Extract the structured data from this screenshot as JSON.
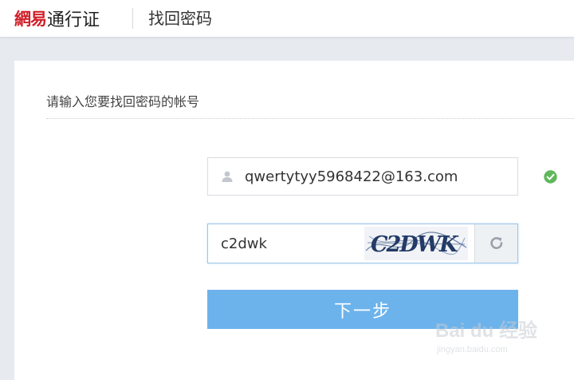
{
  "header": {
    "brand": "網易",
    "product": "通行证",
    "page_title": "找回密码"
  },
  "main": {
    "section_title": "请输入您要找回密码的帐号",
    "account": {
      "value": "qwertytyy5968422@163.com",
      "icon": "user-icon",
      "status_icon": "check-circle-icon",
      "status_color": "#5fb85c"
    },
    "captcha": {
      "value": "c2dwk",
      "image_text": "C2DWK",
      "refresh_icon": "refresh-icon"
    },
    "next_button": {
      "label": "下一步",
      "color": "#6cb3ec"
    }
  },
  "watermark": {
    "text": "Bai du 经验",
    "url": "jingyan.baidu.com"
  },
  "colors": {
    "brand_red": "#d0202a",
    "page_bg": "#e7ebf0"
  }
}
